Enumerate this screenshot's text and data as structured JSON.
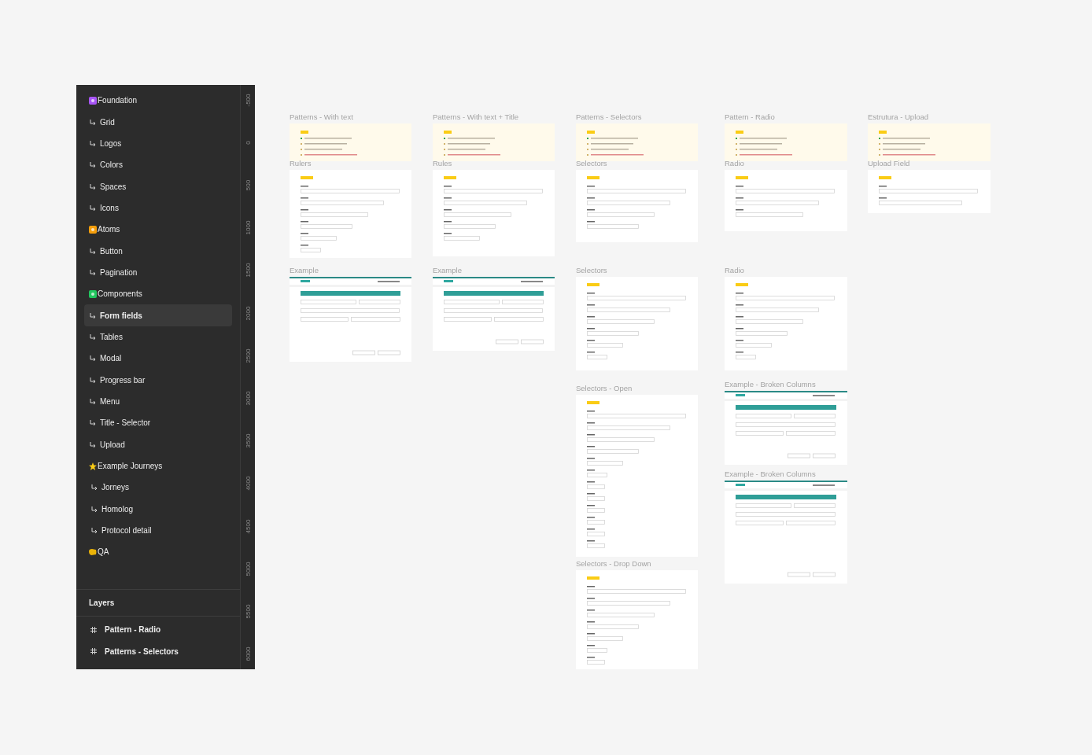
{
  "pages": [
    {
      "label": "Foundation",
      "color": "#a855f7",
      "selected": false,
      "children": [
        {
          "label": "Grid",
          "selected": false
        },
        {
          "label": "Logos",
          "selected": false
        },
        {
          "label": "Colors",
          "selected": false
        },
        {
          "label": "Spaces",
          "selected": false
        },
        {
          "label": "Icons",
          "selected": false
        }
      ]
    },
    {
      "label": "Atoms",
      "color": "#f59e0b",
      "selected": false,
      "children": [
        {
          "label": "Button",
          "selected": false
        },
        {
          "label": "Pagination",
          "selected": false
        }
      ]
    },
    {
      "label": "Components",
      "color": "#22c55e",
      "selected": false,
      "children": [
        {
          "label": "Form fields",
          "selected": true
        },
        {
          "label": "Tables",
          "selected": false
        },
        {
          "label": "Modal",
          "selected": false
        },
        {
          "label": "Progress bar",
          "selected": false
        },
        {
          "label": "Menu",
          "selected": false
        },
        {
          "label": "Title - Selector",
          "selected": false
        },
        {
          "label": "Upload",
          "selected": false
        }
      ]
    },
    {
      "label": "Example Journeys",
      "color": "#facc15",
      "selected": false,
      "children": [
        {
          "label": "Jorneys",
          "selected": false
        },
        {
          "label": "Homolog",
          "selected": false
        },
        {
          "label": "Protocol detail",
          "selected": false
        }
      ]
    },
    {
      "label": "QA",
      "color": "#eab308",
      "selected": false
    }
  ],
  "layers": {
    "title": "Layers",
    "items": [
      {
        "label": "Pattern - Radio"
      },
      {
        "label": "Patterns - Selectors"
      }
    ]
  },
  "ruler": [
    "-500",
    "0",
    "500",
    "1000",
    "1500",
    "2000",
    "2500",
    "3000",
    "3500",
    "4000",
    "4500",
    "5000",
    "5500",
    "6000"
  ],
  "frames": [
    {
      "title": "Patterns - With text",
      "kind": "notes"
    },
    {
      "title": "Rulers",
      "kind": "form"
    },
    {
      "title": "Example",
      "kind": "page"
    },
    {
      "title": "Patterns - With text + Title",
      "kind": "notes"
    },
    {
      "title": "Rules",
      "kind": "form"
    },
    {
      "title": "Example",
      "kind": "page"
    },
    {
      "title": "Patterns - Selectors",
      "kind": "notes"
    },
    {
      "title": "Selectors",
      "kind": "form"
    },
    {
      "title": "Selectors",
      "kind": "form"
    },
    {
      "title": "Selectors - Open",
      "kind": "form"
    },
    {
      "title": "Selectors - Drop Down",
      "kind": "form"
    },
    {
      "title": "Pattern - Radio",
      "kind": "notes"
    },
    {
      "title": "Radio",
      "kind": "form"
    },
    {
      "title": "Radio",
      "kind": "form"
    },
    {
      "title": "Example - Broken Columns",
      "kind": "page"
    },
    {
      "title": "Example - Broken Columns",
      "kind": "page"
    },
    {
      "title": "Estrutura - Upload",
      "kind": "notes"
    },
    {
      "title": "Upload Field",
      "kind": "form"
    }
  ]
}
